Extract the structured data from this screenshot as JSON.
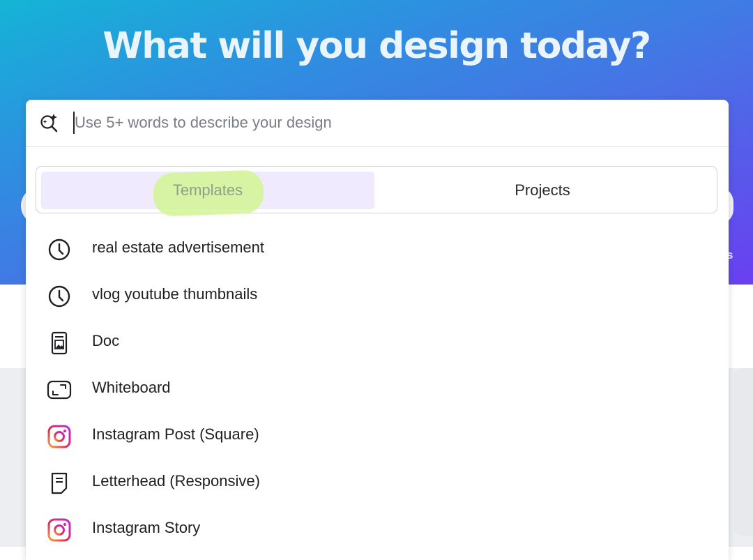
{
  "hero": {
    "title": "What will you design today?"
  },
  "search": {
    "placeholder": "Use 5+ words to describe your design",
    "icon": "ai-search-icon"
  },
  "tabs": [
    {
      "label": "Templates",
      "selected": true
    },
    {
      "label": "Projects",
      "selected": false
    }
  ],
  "suggestions": [
    {
      "label": "real estate advertisement",
      "icon": "clock-icon"
    },
    {
      "label": "vlog youtube thumbnails",
      "icon": "clock-icon"
    },
    {
      "label": "Doc",
      "icon": "doc-icon"
    },
    {
      "label": "Whiteboard",
      "icon": "whiteboard-icon"
    },
    {
      "label": "Instagram Post (Square)",
      "icon": "instagram-icon"
    },
    {
      "label": "Letterhead (Responsive)",
      "icon": "letterhead-icon"
    },
    {
      "label": "Instagram Story",
      "icon": "instagram-icon"
    }
  ],
  "background": {
    "partial_text": "s"
  },
  "colors": {
    "tab_selected_bg": "#efeafe",
    "highlight_marker": "#d4f59a",
    "gradient_start": "#14b4d6",
    "gradient_end": "#6a3ff0"
  }
}
